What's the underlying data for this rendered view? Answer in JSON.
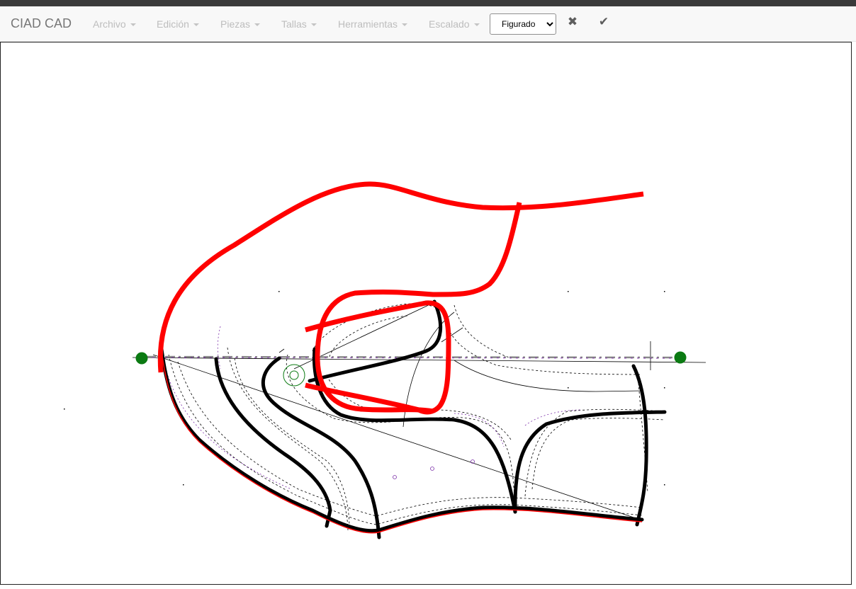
{
  "app": {
    "brand": "CIAD CAD"
  },
  "menubar": {
    "items": [
      {
        "label": "Archivo",
        "key": "archivo"
      },
      {
        "label": "Edición",
        "key": "edicion"
      },
      {
        "label": "Piezas",
        "key": "piezas"
      },
      {
        "label": "Tallas",
        "key": "tallas"
      },
      {
        "label": "Herramientas",
        "key": "herramientas"
      },
      {
        "label": "Escalado",
        "key": "escalado"
      }
    ]
  },
  "toolbar": {
    "mode_select": {
      "selected": "Figurado",
      "options": [
        "Figurado"
      ]
    },
    "cancel_icon": "close-icon",
    "confirm_icon": "check-icon"
  },
  "canvas": {
    "description_colors": {
      "pattern_red": "#ff0000",
      "pattern_black": "#000000",
      "guide_purple": "#7b2fa8",
      "handle_green": "#0b7a12"
    }
  }
}
